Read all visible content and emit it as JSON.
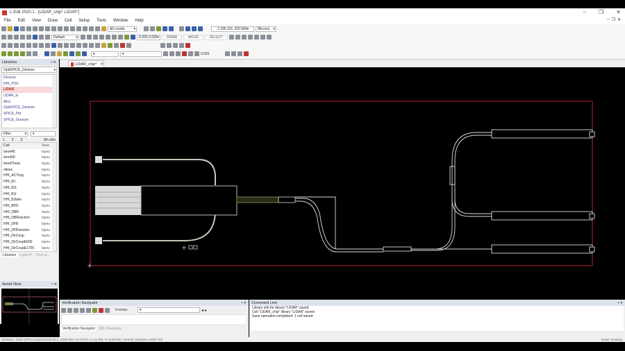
{
  "window": {
    "title": "L-Edit 2020.1 - [LiDAR_chip*     LIDAR*]",
    "controls": [
      "–",
      "❐",
      "✕"
    ]
  },
  "menu": [
    "File",
    "Edit",
    "View",
    "Draw",
    "Cell",
    "Setup",
    "Tools",
    "Window",
    "Help"
  ],
  "toolbar": {
    "levels": "All Levels",
    "style": "Default",
    "coord": "0.000 0.000",
    "draw": "DRAW",
    "move": "MOVE",
    "select": "SELECT",
    "cursor": "1.195.116, 320.965",
    "units": "Microns",
    "snap": "0.001"
  },
  "doc_tab": "LiDAR_chip*",
  "libraries": {
    "title": "Libraries",
    "selected_lib": "OptiSPICE_Devices",
    "items": [
      "Devices",
      "HHI_PDK",
      "LIDAR",
      "LIDAR_lo",
      "Misc",
      "OptiSPICE_Devices",
      "SPICE_Ptd",
      "SPICE_Sources"
    ],
    "selected_index": 2,
    "filter": "Filter",
    "tabs": [
      "1",
      "2",
      "3"
    ],
    "cell_count": "94 cells",
    "columns": [
      "Cell",
      "View"
    ],
    "cells": [
      [
        "bend45",
        "layou"
      ],
      [
        "bend90",
        "layou"
      ],
      [
        "bendTheta",
        "layou"
      ],
      [
        "elbow",
        "layou"
      ],
      [
        "HHI_ACTcirg",
        "layou"
      ],
      [
        "HHI_BJ",
        "layou"
      ],
      [
        "HHI_BJI",
        "layou"
      ],
      [
        "HHI_BJr",
        "layou"
      ],
      [
        "HHI_BJtwin",
        "layou"
      ],
      [
        "HHI_BPD",
        "layou"
      ],
      [
        "HHI_DBR",
        "layou"
      ],
      [
        "HHI_DBRsection",
        "layou"
      ],
      [
        "HHI_DFB",
        "layou"
      ],
      [
        "HHI_DFBsection",
        "layou"
      ],
      [
        "HHI_DirCoup",
        "layou"
      ],
      [
        "HHI_DirCoupE600",
        "layou"
      ],
      [
        "HHI_DirCoupE1700",
        "layou"
      ]
    ],
    "bottom_tabs": [
      "Libraries",
      "Layer P...",
      "Find ar..."
    ]
  },
  "aerial": {
    "title": "Aerial View"
  },
  "verification": {
    "title": "Verification Navigator",
    "errors": "0 errors",
    "tabs": [
      "Verification Navigator",
      "SDL Navigator"
    ]
  },
  "command_line": {
    "title": "Command Line",
    "messages": [
      "Library info for library \"LIDAR\" saved",
      "Cell \"LIDAR_chip\" library \"LIDAR\" saved",
      "Save operation completed: 1 cell saved"
    ]
  },
  "status": {
    "text": "Selection: (Wire (RR Exclusionchannel) L=1069.960, W=0.070, A=13.399, P=1138.960, Vertical, Squares=15497.00)",
    "mode": "Mode: Drawing"
  },
  "colors": {
    "canvas": "#000000",
    "boundary": "#c0202a",
    "waveguide": "#c8c8b8"
  }
}
